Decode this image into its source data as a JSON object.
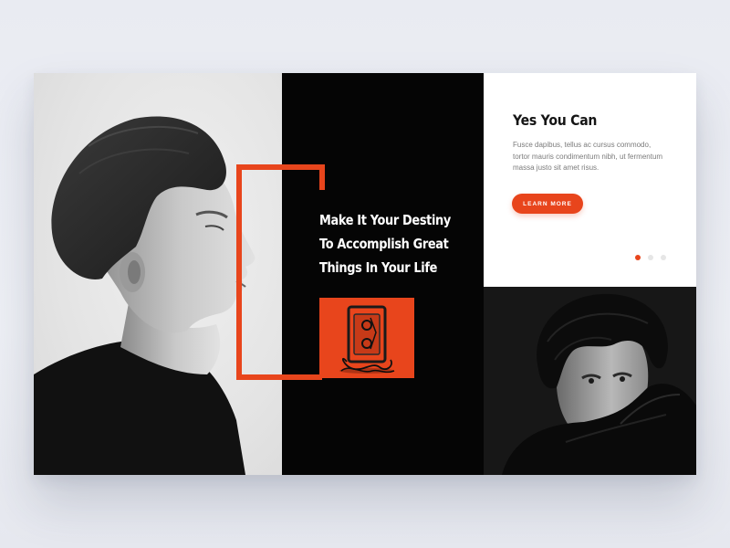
{
  "hero": {
    "headline_lines": [
      "Make It Your Destiny",
      "To Accomplish Great",
      "Things In Your Life"
    ]
  },
  "side": {
    "title": "Yes You Can",
    "body": "Fusce dapibus, tellus ac cursus commodo, tortor mauris condimentum nibh, ut fermentum massa justo sit amet risus.",
    "button_label": "LEARN MORE"
  },
  "carousel": {
    "total": 3,
    "active": 1
  },
  "colors": {
    "accent": "#e8451c",
    "dark_panel": "#050505",
    "card_bg": "#ffffff",
    "page_bg": "#eceef4"
  },
  "images": {
    "left": "portrait-profile-photo",
    "thumbnail": "cassette-tape-photo",
    "bottom_right": "portrait-turtleneck-photo"
  }
}
